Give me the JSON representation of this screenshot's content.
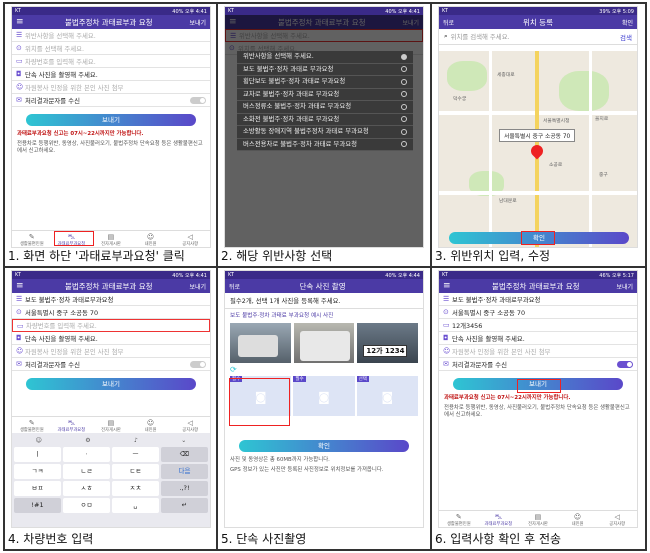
{
  "captions": [
    "1. 화면 하단 '과태료부과요청' 클릭",
    "2. 해당 위반사항 선택",
    "3. 위반위치 입력, 수정",
    "4. 차량번호 입력",
    "5. 단속 사진촬영",
    "6. 입력사항 확인 후 전송"
  ],
  "common": {
    "status_left": "KT",
    "status_right": "40% 오후 4:41",
    "title": "불법주정차 과태료부과 요청",
    "send_action": "보내기",
    "tabs": [
      "생활불편민원",
      "과태료부과요청",
      "전자게시판",
      "내민원",
      "공지사항"
    ]
  },
  "form": {
    "violation_placeholder": "위반사항을 선택해 주세요.",
    "violation_value": "보도 불법주·정차 과태료부과요청",
    "location_placeholder": "위치를 선택해 주세요.",
    "location_value": "서울특별시 중구 소공동 70",
    "plate_placeholder": "차량번호를 입력해 주세요.",
    "plate_value": "12개3456",
    "photo_row": "단속 사진을 촬영해 주세요.",
    "attach_row": "자원봉사 인정을 위한 본인 사진 첨부",
    "result_sms": "처리결과문자를 수신",
    "send_button": "보내기",
    "notice_red": "과태료부과요청 신고는 07시~22시까지만 가능합니다.",
    "notice_body": "전용차로 등행위반, 동영상, 사진불러오기, 불법주정차 단속요청 등은 생활불편신고에서 신고하세요."
  },
  "dialog": {
    "items": [
      "위반사항을 선택해 주세요.",
      "보도 불법주·정차 과태료 부과요청",
      "횡단보도 불법주·정차 과태료 부과요청",
      "교차로 불법주·정차 과태료 부과요청",
      "버스정류소 불법주·정차 과태료 부과요청",
      "소화전 불법주·정차 과태료 부과요청",
      "소방활동 장애지역 불법주정차 과태료 부과요청",
      "버스전용차로 불법주·정차 과태료 부과요청"
    ]
  },
  "location": {
    "status_right": "39% 오후 5:09",
    "back": "뒤로",
    "title": "위치 등록",
    "confirm_action": "확인",
    "search_placeholder": "위치를 검색해 주세요.",
    "search_button": "검색",
    "callout": "서울특별시 중구 소공동 70",
    "map_labels": [
      "서울특별시청",
      "덕수궁",
      "중구",
      "을지로",
      "남대문로",
      "소공로",
      "세종대로"
    ],
    "confirm_button": "확인"
  },
  "keyboard": {
    "rows": [
      [
        "ㅣ",
        "ㆍ",
        "ㅡ",
        "⌫"
      ],
      [
        "ㄱㅋ",
        "ㄴㄹ",
        "ㄷㅌ",
        "다음"
      ],
      [
        "ㅂㅍ",
        "ㅅㅎ",
        "ㅈㅊ",
        ".,?!"
      ],
      [
        "!#1",
        "ㅇㅁ",
        "␣",
        "↵"
      ]
    ]
  },
  "photo": {
    "status_right": "40% 오후 4:44",
    "back": "뒤로",
    "title": "단속 사진 촬영",
    "guide": "필수2개, 선택 1개 사진을 등록해 주세요.",
    "sub": "보도 불법주·정차 과태료 부과요청 예시 사진",
    "plate_text": "12가 1234",
    "slot_labels": [
      "필수",
      "필수",
      "선택"
    ],
    "confirm_button": "확인",
    "notes": [
      "사진 및 동영상은 총 60MB까지 가능합니다.",
      "GPS 정보가 있는 사진만 등록된 사진정보로 위치정보를 가져옵니다."
    ]
  },
  "final": {
    "status_right": "46% 오후 5:17"
  },
  "colors": {
    "brand": "#4b3aa5",
    "accent": "#5a48c9",
    "highlight": "#e22222"
  }
}
